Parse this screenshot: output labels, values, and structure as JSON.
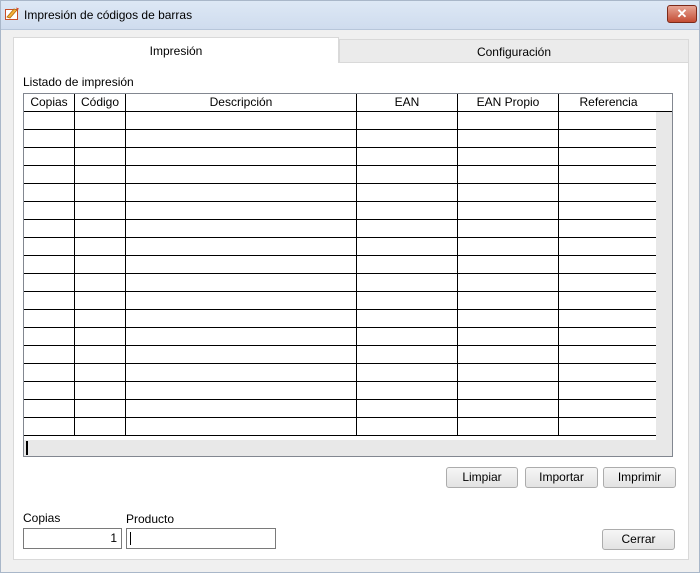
{
  "window": {
    "title": "Impresión de códigos de barras",
    "close_label": "✕"
  },
  "tabs": [
    {
      "label": "Impresión",
      "active": true
    },
    {
      "label": "Configuración",
      "active": false
    }
  ],
  "print_list": {
    "label": "Listado de impresión",
    "columns": [
      "Copias",
      "Código",
      "Descripción",
      "EAN",
      "EAN Propio",
      "Referencia"
    ],
    "rows": [
      [
        "",
        "",
        "",
        "",
        "",
        ""
      ],
      [
        "",
        "",
        "",
        "",
        "",
        ""
      ],
      [
        "",
        "",
        "",
        "",
        "",
        ""
      ],
      [
        "",
        "",
        "",
        "",
        "",
        ""
      ],
      [
        "",
        "",
        "",
        "",
        "",
        ""
      ],
      [
        "",
        "",
        "",
        "",
        "",
        ""
      ],
      [
        "",
        "",
        "",
        "",
        "",
        ""
      ],
      [
        "",
        "",
        "",
        "",
        "",
        ""
      ],
      [
        "",
        "",
        "",
        "",
        "",
        ""
      ],
      [
        "",
        "",
        "",
        "",
        "",
        ""
      ],
      [
        "",
        "",
        "",
        "",
        "",
        ""
      ],
      [
        "",
        "",
        "",
        "",
        "",
        ""
      ],
      [
        "",
        "",
        "",
        "",
        "",
        ""
      ],
      [
        "",
        "",
        "",
        "",
        "",
        ""
      ],
      [
        "",
        "",
        "",
        "",
        "",
        ""
      ],
      [
        "",
        "",
        "",
        "",
        "",
        ""
      ],
      [
        "",
        "",
        "",
        "",
        "",
        ""
      ],
      [
        "",
        "",
        "",
        "",
        "",
        ""
      ]
    ]
  },
  "actions": {
    "clear_label": "Limpiar",
    "import_label": "Importar",
    "print_label": "Imprimir"
  },
  "form": {
    "copies_label": "Copias",
    "copies_value": "1",
    "product_label": "Producto",
    "product_value": ""
  },
  "footer": {
    "close_label": "Cerrar"
  },
  "colors": {
    "titlebar": "#dde8f5",
    "close_button": "#c44d34",
    "panel": "#ffffff",
    "grid_border": "#828790"
  }
}
